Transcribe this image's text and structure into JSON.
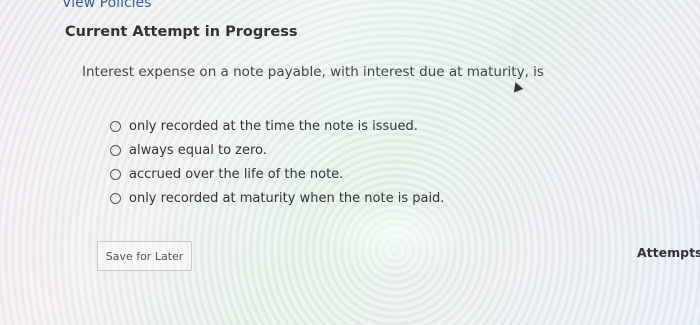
{
  "nav": {
    "view_policies": "View Policies"
  },
  "attempt": {
    "heading": "Current Attempt in Progress"
  },
  "question": {
    "text": "Interest expense on a note payable, with interest due at maturity, is",
    "options": [
      {
        "label": "only recorded at the time the note is issued."
      },
      {
        "label": "always equal to zero."
      },
      {
        "label": "accrued over the life of the note."
      },
      {
        "label": "only recorded at maturity when the note is paid."
      }
    ]
  },
  "actions": {
    "save_label": "Save for Later"
  },
  "attempts": {
    "label": "Attempts:"
  }
}
